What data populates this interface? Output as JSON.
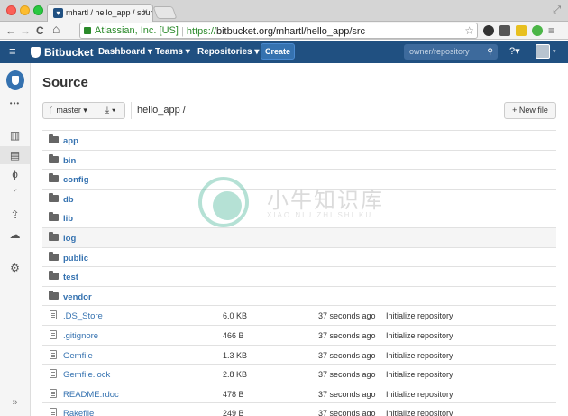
{
  "browser": {
    "tab_title": "mhartl / hello_app / sourc",
    "tab_close": "×",
    "back_glyph": "←",
    "forward_glyph": "→",
    "reload_glyph": "C",
    "home_glyph": "⌂",
    "ev_label": "Atlassian, Inc. [US]",
    "url_scheme": "https://",
    "url_rest": "bitbucket.org/mhartl/hello_app/src",
    "star_glyph": "☆",
    "menu_glyph": "≡",
    "fullscreen_glyph": "⤢"
  },
  "header": {
    "brand": "Bitbucket",
    "nav": {
      "dashboard": "Dashboard ▾",
      "teams": "Teams ▾",
      "repositories": "Repositories ▾"
    },
    "create_label": "Create",
    "search_placeholder": "owner/repository",
    "search_glyph": "⚲",
    "help_label": "?▾",
    "avatar_caret": "▾",
    "hamburger_glyph": "≡"
  },
  "sidebar": {
    "more_glyph": "•••",
    "stats_glyph": "▥",
    "source_glyph": "▤",
    "commits_glyph": "ɸ",
    "branches_glyph": "ᚴ",
    "pullrequests_glyph": "⇪",
    "downloads_glyph": "☁",
    "settings_glyph": "⚙",
    "collapse_glyph": "»"
  },
  "main": {
    "title": "Source",
    "branch_label": "master ▾",
    "branch_glyph": "ᚴ",
    "download_label": "⤓ ▾",
    "breadcrumb": "hello_app /",
    "new_file_label": "+ New file",
    "folders": [
      {
        "name": "app"
      },
      {
        "name": "bin"
      },
      {
        "name": "config"
      },
      {
        "name": "db"
      },
      {
        "name": "lib"
      },
      {
        "name": "log"
      },
      {
        "name": "public"
      },
      {
        "name": "test"
      },
      {
        "name": "vendor"
      }
    ],
    "files": [
      {
        "name": ".DS_Store",
        "size": "6.0 KB",
        "age": "37 seconds ago",
        "message": "Initialize repository"
      },
      {
        "name": ".gitignore",
        "size": "466 B",
        "age": "37 seconds ago",
        "message": "Initialize repository"
      },
      {
        "name": "Gemfile",
        "size": "1.3 KB",
        "age": "37 seconds ago",
        "message": "Initialize repository"
      },
      {
        "name": "Gemfile.lock",
        "size": "2.8 KB",
        "age": "37 seconds ago",
        "message": "Initialize repository"
      },
      {
        "name": "README.rdoc",
        "size": "478 B",
        "age": "37 seconds ago",
        "message": "Initialize repository"
      },
      {
        "name": "Rakefile",
        "size": "249 B",
        "age": "37 seconds ago",
        "message": "Initialize repository"
      }
    ]
  },
  "watermark": {
    "cn": "小牛知识库",
    "en": "XIAO NIU ZHI SHI KU"
  },
  "colors": {
    "header_bg": "#205081",
    "link": "#3572b0",
    "ev_green": "#2a8a2a"
  }
}
